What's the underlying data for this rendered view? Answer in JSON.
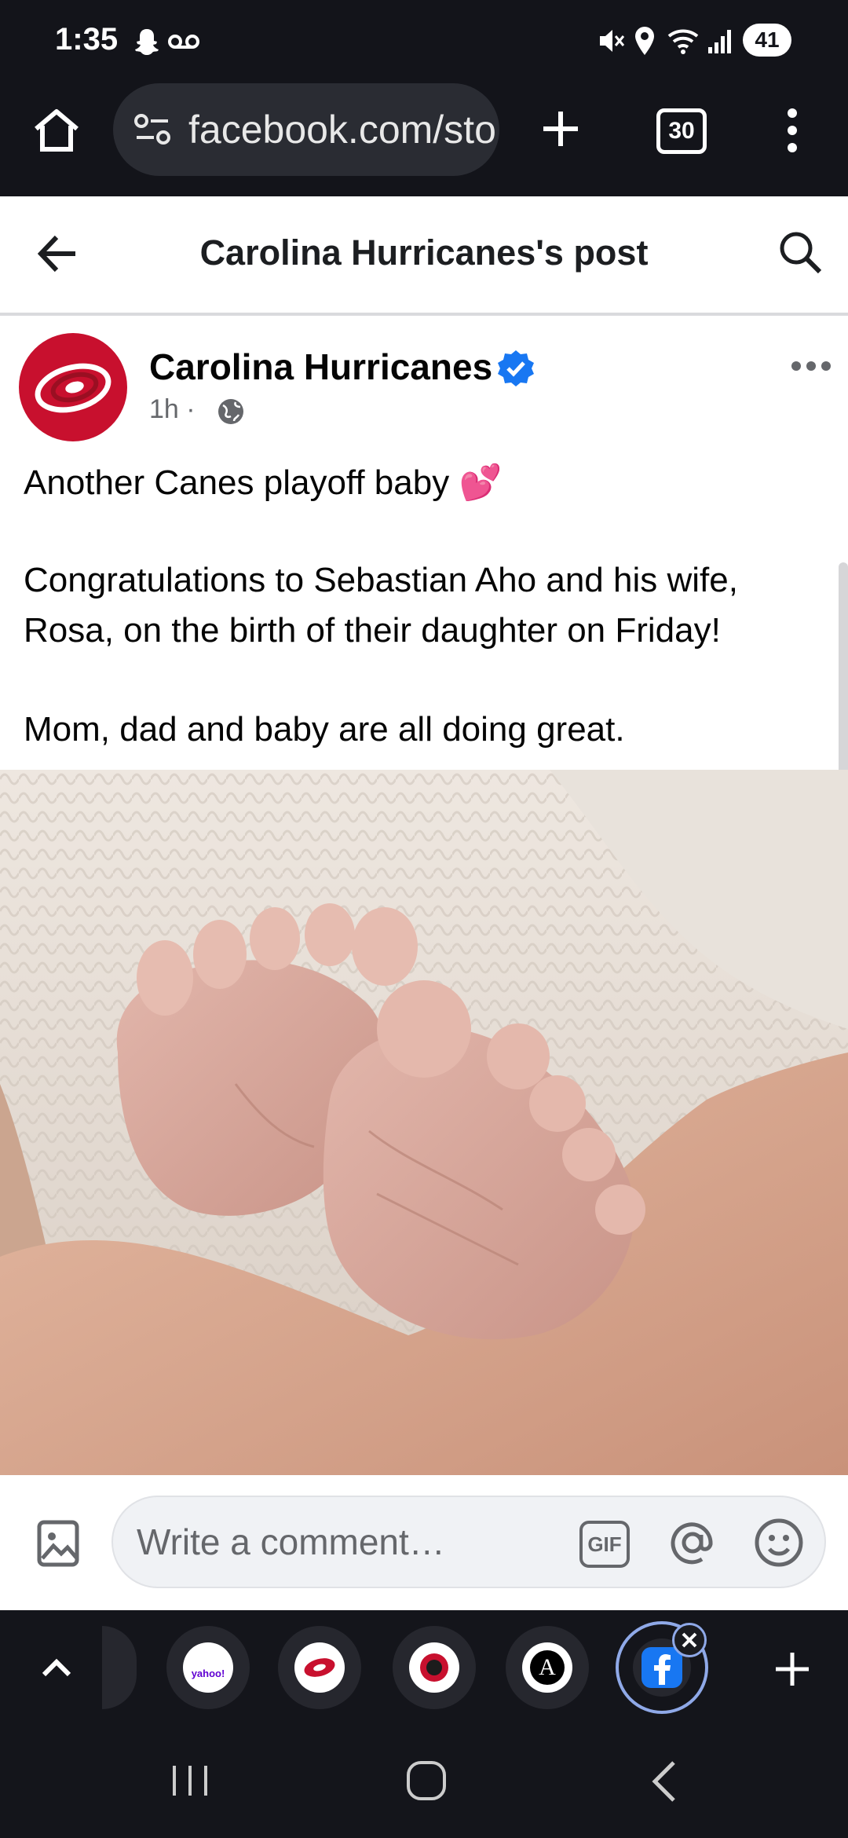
{
  "status": {
    "time": "1:35",
    "battery": "41"
  },
  "browser": {
    "url": "facebook.com/sto",
    "tab_count": "30"
  },
  "header": {
    "title": "Carolina Hurricanes's post"
  },
  "post": {
    "page_name": "Carolina Hurricanes",
    "time": "1h",
    "lines": [
      "Another Canes playoff baby 💕",
      "",
      "Congratulations to Sebastian Aho and his wife,",
      "Rosa, on the birth of their daughter on Friday!",
      "",
      "Mom, dad and baby are all doing great."
    ]
  },
  "comment": {
    "placeholder": "Write a comment…",
    "gif_label": "GIF"
  },
  "tabs": {
    "yahoo_label": "yahoo!",
    "athletic_letter": "A"
  },
  "colors": {
    "dark": "#13141a",
    "verified": "#1877f2",
    "canes_red": "#c8102e"
  }
}
